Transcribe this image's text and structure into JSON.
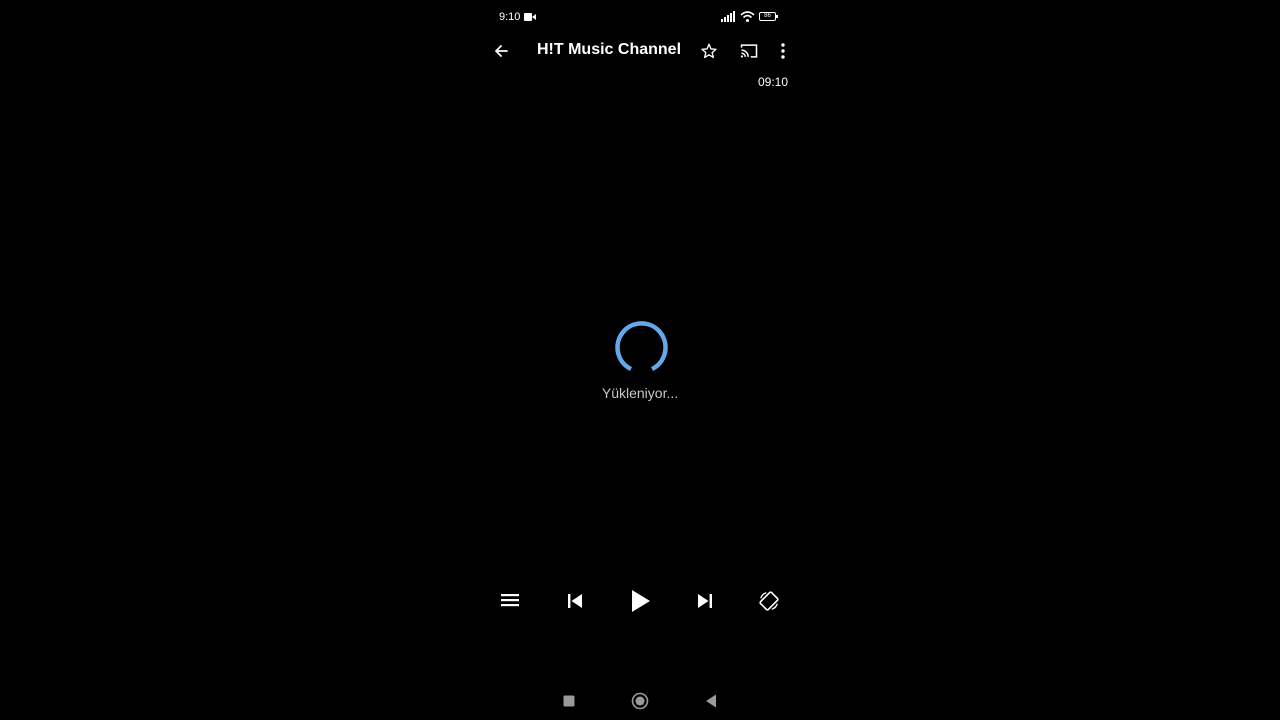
{
  "status_bar": {
    "time": "9:10",
    "battery": "86",
    "icons": [
      "video-camera-icon",
      "signal-icon",
      "wifi-icon",
      "battery-icon"
    ]
  },
  "toolbar": {
    "title": "H!T Music Channel",
    "icons": [
      "back-arrow-icon",
      "star-icon",
      "cast-icon",
      "more-vertical-icon"
    ]
  },
  "player": {
    "clock": "09:10",
    "loading_text": "Yükleniyor...",
    "spinner_color": "#64a8ec"
  },
  "controls": {
    "icons": [
      "playlist-icon",
      "skip-previous-icon",
      "play-icon",
      "skip-next-icon",
      "screen-rotation-icon"
    ]
  },
  "nav_bar": {
    "icons": [
      "recents-square-icon",
      "home-circle-icon",
      "back-triangle-icon"
    ]
  }
}
